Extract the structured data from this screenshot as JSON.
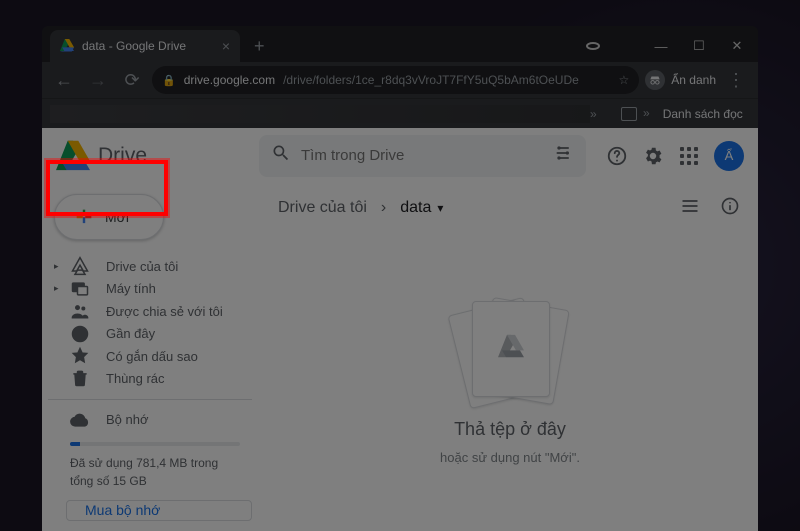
{
  "window": {
    "tab_title": "data - Google Drive",
    "new_tab_tooltip": "+"
  },
  "address_bar": {
    "host": "drive.google.com",
    "path": "/drive/folders/1ce_r8dq3vVroJT7FfY5uQ5bAm6tOeUDe",
    "profile_label": "Ẩn danh"
  },
  "bookmarks": {
    "reading_list": "Danh sách đọc"
  },
  "app": {
    "brand": "Drive",
    "search_placeholder": "Tìm trong Drive"
  },
  "sidebar": {
    "new_label": "Mới",
    "items": [
      {
        "label": "Drive của tôi",
        "expandable": true
      },
      {
        "label": "Máy tính",
        "expandable": true
      },
      {
        "label": "Được chia sẻ với tôi",
        "expandable": false
      },
      {
        "label": "Gần đây",
        "expandable": false
      },
      {
        "label": "Có gắn dấu sao",
        "expandable": false
      },
      {
        "label": "Thùng rác",
        "expandable": false
      }
    ],
    "storage_label": "Bộ nhớ",
    "storage_text": "Đã sử dụng 781,4 MB trong tổng số 15 GB",
    "storage_used_pct": 5,
    "buy_label": "Mua bộ nhớ"
  },
  "main": {
    "breadcrumb_root": "Drive của tôi",
    "breadcrumb_current": "data",
    "dropzone_title": "Thả tệp ở đây",
    "dropzone_sub": "hoặc sử dụng nút \"Mới\"."
  }
}
